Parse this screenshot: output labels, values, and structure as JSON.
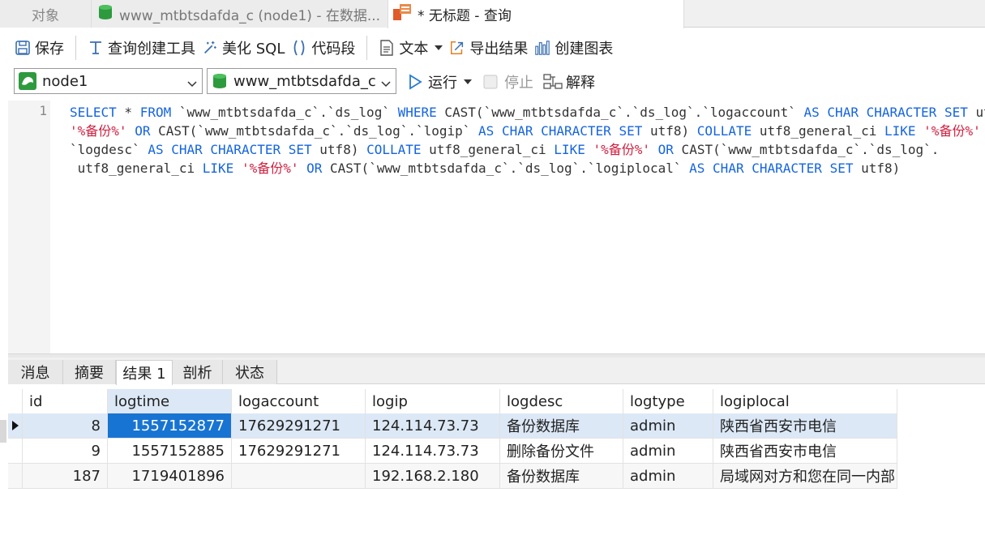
{
  "tabs": {
    "objects": "对象",
    "connection": "www_mtbtsdafda_c (node1) - 在数据...",
    "query": "* 无标题 - 查询"
  },
  "toolbar": {
    "save": "保存",
    "query_builder": "查询创建工具",
    "beautify": "美化 SQL",
    "snippet": "代码段",
    "text": "文本",
    "export": "导出结果",
    "chart": "创建图表"
  },
  "toolbar2": {
    "connection": "node1",
    "database": "www_mtbtsdafda_c",
    "run": "运行",
    "stop": "停止",
    "explain": "解释"
  },
  "editor": {
    "line_number": "1"
  },
  "result_tabs": [
    "消息",
    "摘要",
    "结果 1",
    "剖析",
    "状态"
  ],
  "grid": {
    "columns": [
      "id",
      "logtime",
      "logaccount",
      "logip",
      "logdesc",
      "logtype",
      "logiplocal"
    ],
    "rows": [
      [
        "8",
        "1557152877",
        "17629291271",
        "124.114.73.73",
        "备份数据库",
        "admin",
        "陕西省西安市电信"
      ],
      [
        "9",
        "1557152885",
        "17629291271",
        "124.114.73.73",
        "删除备份文件",
        "admin",
        "陕西省西安市电信"
      ],
      [
        "187",
        "1719401896",
        "",
        "192.168.2.180",
        "备份数据库",
        "admin",
        "局域网对方和您在同一内部"
      ]
    ]
  },
  "colors": {
    "keyword": "#1565e0",
    "string": "#d02040",
    "selection": "#1874d2",
    "row_highlight": "#dce8f6"
  }
}
